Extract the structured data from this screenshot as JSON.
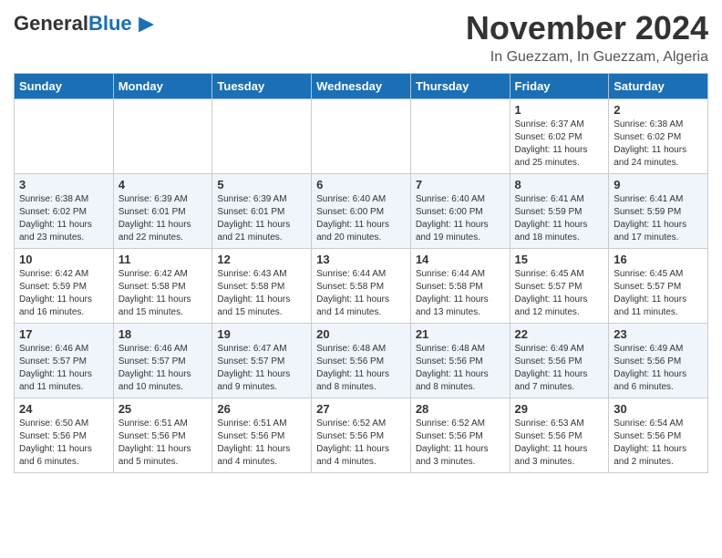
{
  "header": {
    "logo_general": "General",
    "logo_blue": "Blue",
    "month_title": "November 2024",
    "location": "In Guezzam, In Guezzam, Algeria"
  },
  "weekdays": [
    "Sunday",
    "Monday",
    "Tuesday",
    "Wednesday",
    "Thursday",
    "Friday",
    "Saturday"
  ],
  "weeks": [
    [
      {
        "day": "",
        "info": ""
      },
      {
        "day": "",
        "info": ""
      },
      {
        "day": "",
        "info": ""
      },
      {
        "day": "",
        "info": ""
      },
      {
        "day": "",
        "info": ""
      },
      {
        "day": "1",
        "info": "Sunrise: 6:37 AM\nSunset: 6:02 PM\nDaylight: 11 hours and 25 minutes."
      },
      {
        "day": "2",
        "info": "Sunrise: 6:38 AM\nSunset: 6:02 PM\nDaylight: 11 hours and 24 minutes."
      }
    ],
    [
      {
        "day": "3",
        "info": "Sunrise: 6:38 AM\nSunset: 6:02 PM\nDaylight: 11 hours and 23 minutes."
      },
      {
        "day": "4",
        "info": "Sunrise: 6:39 AM\nSunset: 6:01 PM\nDaylight: 11 hours and 22 minutes."
      },
      {
        "day": "5",
        "info": "Sunrise: 6:39 AM\nSunset: 6:01 PM\nDaylight: 11 hours and 21 minutes."
      },
      {
        "day": "6",
        "info": "Sunrise: 6:40 AM\nSunset: 6:00 PM\nDaylight: 11 hours and 20 minutes."
      },
      {
        "day": "7",
        "info": "Sunrise: 6:40 AM\nSunset: 6:00 PM\nDaylight: 11 hours and 19 minutes."
      },
      {
        "day": "8",
        "info": "Sunrise: 6:41 AM\nSunset: 5:59 PM\nDaylight: 11 hours and 18 minutes."
      },
      {
        "day": "9",
        "info": "Sunrise: 6:41 AM\nSunset: 5:59 PM\nDaylight: 11 hours and 17 minutes."
      }
    ],
    [
      {
        "day": "10",
        "info": "Sunrise: 6:42 AM\nSunset: 5:59 PM\nDaylight: 11 hours and 16 minutes."
      },
      {
        "day": "11",
        "info": "Sunrise: 6:42 AM\nSunset: 5:58 PM\nDaylight: 11 hours and 15 minutes."
      },
      {
        "day": "12",
        "info": "Sunrise: 6:43 AM\nSunset: 5:58 PM\nDaylight: 11 hours and 15 minutes."
      },
      {
        "day": "13",
        "info": "Sunrise: 6:44 AM\nSunset: 5:58 PM\nDaylight: 11 hours and 14 minutes."
      },
      {
        "day": "14",
        "info": "Sunrise: 6:44 AM\nSunset: 5:58 PM\nDaylight: 11 hours and 13 minutes."
      },
      {
        "day": "15",
        "info": "Sunrise: 6:45 AM\nSunset: 5:57 PM\nDaylight: 11 hours and 12 minutes."
      },
      {
        "day": "16",
        "info": "Sunrise: 6:45 AM\nSunset: 5:57 PM\nDaylight: 11 hours and 11 minutes."
      }
    ],
    [
      {
        "day": "17",
        "info": "Sunrise: 6:46 AM\nSunset: 5:57 PM\nDaylight: 11 hours and 11 minutes."
      },
      {
        "day": "18",
        "info": "Sunrise: 6:46 AM\nSunset: 5:57 PM\nDaylight: 11 hours and 10 minutes."
      },
      {
        "day": "19",
        "info": "Sunrise: 6:47 AM\nSunset: 5:57 PM\nDaylight: 11 hours and 9 minutes."
      },
      {
        "day": "20",
        "info": "Sunrise: 6:48 AM\nSunset: 5:56 PM\nDaylight: 11 hours and 8 minutes."
      },
      {
        "day": "21",
        "info": "Sunrise: 6:48 AM\nSunset: 5:56 PM\nDaylight: 11 hours and 8 minutes."
      },
      {
        "day": "22",
        "info": "Sunrise: 6:49 AM\nSunset: 5:56 PM\nDaylight: 11 hours and 7 minutes."
      },
      {
        "day": "23",
        "info": "Sunrise: 6:49 AM\nSunset: 5:56 PM\nDaylight: 11 hours and 6 minutes."
      }
    ],
    [
      {
        "day": "24",
        "info": "Sunrise: 6:50 AM\nSunset: 5:56 PM\nDaylight: 11 hours and 6 minutes."
      },
      {
        "day": "25",
        "info": "Sunrise: 6:51 AM\nSunset: 5:56 PM\nDaylight: 11 hours and 5 minutes."
      },
      {
        "day": "26",
        "info": "Sunrise: 6:51 AM\nSunset: 5:56 PM\nDaylight: 11 hours and 4 minutes."
      },
      {
        "day": "27",
        "info": "Sunrise: 6:52 AM\nSunset: 5:56 PM\nDaylight: 11 hours and 4 minutes."
      },
      {
        "day": "28",
        "info": "Sunrise: 6:52 AM\nSunset: 5:56 PM\nDaylight: 11 hours and 3 minutes."
      },
      {
        "day": "29",
        "info": "Sunrise: 6:53 AM\nSunset: 5:56 PM\nDaylight: 11 hours and 3 minutes."
      },
      {
        "day": "30",
        "info": "Sunrise: 6:54 AM\nSunset: 5:56 PM\nDaylight: 11 hours and 2 minutes."
      }
    ]
  ]
}
